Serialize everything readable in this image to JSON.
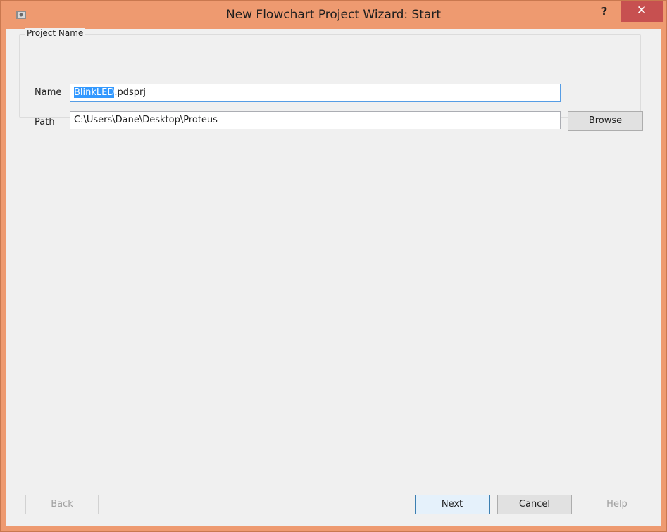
{
  "window": {
    "title": "New Flowchart Project Wizard: Start",
    "help_label": "?",
    "close_label": "✕"
  },
  "project_group": {
    "title": "Project Name",
    "name_label": "Name",
    "name_selected": "BlinkLED",
    "name_suffix": ".pdsprj",
    "path_label": "Path",
    "path_value": "C:\\Users\\Dane\\Desktop\\Proteus",
    "browse_label": "Browse"
  },
  "footer": {
    "back_label": "Back",
    "next_label": "Next",
    "cancel_label": "Cancel",
    "help_label": "Help"
  },
  "colors": {
    "titlebar": "#EE9A70",
    "close_button": "#C75050",
    "selection": "#3399FF",
    "focus_border": "#569DE5"
  }
}
